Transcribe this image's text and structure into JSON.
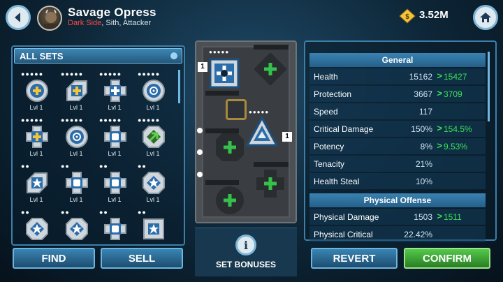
{
  "header": {
    "character_name": "Savage Opress",
    "alignment": "Dark Side",
    "tags": ", Sith, Attacker",
    "credits": "3.52M"
  },
  "left_panel": {
    "set_filter": "ALL SETS",
    "mods": [
      {
        "dots": "●●●●●",
        "level": "Lvl 1",
        "shape": "circle",
        "set": "cross"
      },
      {
        "dots": "●●●●●",
        "level": "Lvl 1",
        "shape": "arrow",
        "set": "cross"
      },
      {
        "dots": "●●●●●",
        "level": "Lvl 1",
        "shape": "cross",
        "set": "health"
      },
      {
        "dots": "●●●●●",
        "level": "Lvl 1",
        "shape": "circle",
        "set": "target"
      },
      {
        "dots": "●●●●●",
        "level": "Lvl 1",
        "shape": "cross",
        "set": "cross"
      },
      {
        "dots": "●●●●●",
        "level": "Lvl 1",
        "shape": "circle",
        "set": "target"
      },
      {
        "dots": "●●●●●",
        "level": "Lvl 1",
        "shape": "cross",
        "set": "fist"
      },
      {
        "dots": "●●●●●",
        "level": "Lvl 1",
        "shape": "diamond",
        "set": "speed"
      },
      {
        "dots": "●●",
        "level": "Lvl 1",
        "shape": "arrow",
        "set": "burst"
      },
      {
        "dots": "●●",
        "level": "Lvl 1",
        "shape": "cross",
        "set": "fist"
      },
      {
        "dots": "●●",
        "level": "Lvl 1",
        "shape": "cross",
        "set": "fist"
      },
      {
        "dots": "●●",
        "level": "Lvl 1",
        "shape": "diamond",
        "set": "burst"
      },
      {
        "dots": "●●",
        "level": "",
        "shape": "diamond",
        "set": "burst"
      },
      {
        "dots": "●●",
        "level": "",
        "shape": "diamond",
        "set": "burst"
      },
      {
        "dots": "●●",
        "level": "",
        "shape": "cross",
        "set": "fist"
      },
      {
        "dots": "●●",
        "level": "",
        "shape": "square",
        "set": "burst"
      }
    ],
    "find_label": "FIND",
    "sell_label": "SELL"
  },
  "slots": {
    "square_level": "1",
    "square_dots": "●●●●●",
    "triangle_level": "1",
    "triangle_dots": "●●●●●",
    "set_bonuses_label": "SET BONUSES",
    "info_glyph": "i"
  },
  "stats": {
    "general_header": "General",
    "general_rows": [
      {
        "label": "Health",
        "old": "15162",
        "new": "15427"
      },
      {
        "label": "Protection",
        "old": "3667",
        "new": "3709"
      },
      {
        "label": "Speed",
        "value": "117"
      },
      {
        "label": "Critical Damage",
        "old": "150%",
        "new": "154.5%"
      },
      {
        "label": "Potency",
        "old": "8%",
        "new": "9.53%"
      },
      {
        "label": "Tenacity",
        "value": "21%"
      },
      {
        "label": "Health Steal",
        "value": "10%"
      }
    ],
    "physical_header": "Physical Offense",
    "physical_rows": [
      {
        "label": "Physical Damage",
        "old": "1503",
        "new": "1511"
      },
      {
        "label": "Physical Critical",
        "value": "22.42%"
      }
    ],
    "arrow_glyph": ">",
    "revert_label": "REVERT",
    "confirm_label": "CONFIRM"
  },
  "colors": {
    "accent_blue": "#3a84b3",
    "increase_green": "#3be05a",
    "dark_side_red": "#ff4a3d",
    "confirm_green": "#2a7d25"
  }
}
